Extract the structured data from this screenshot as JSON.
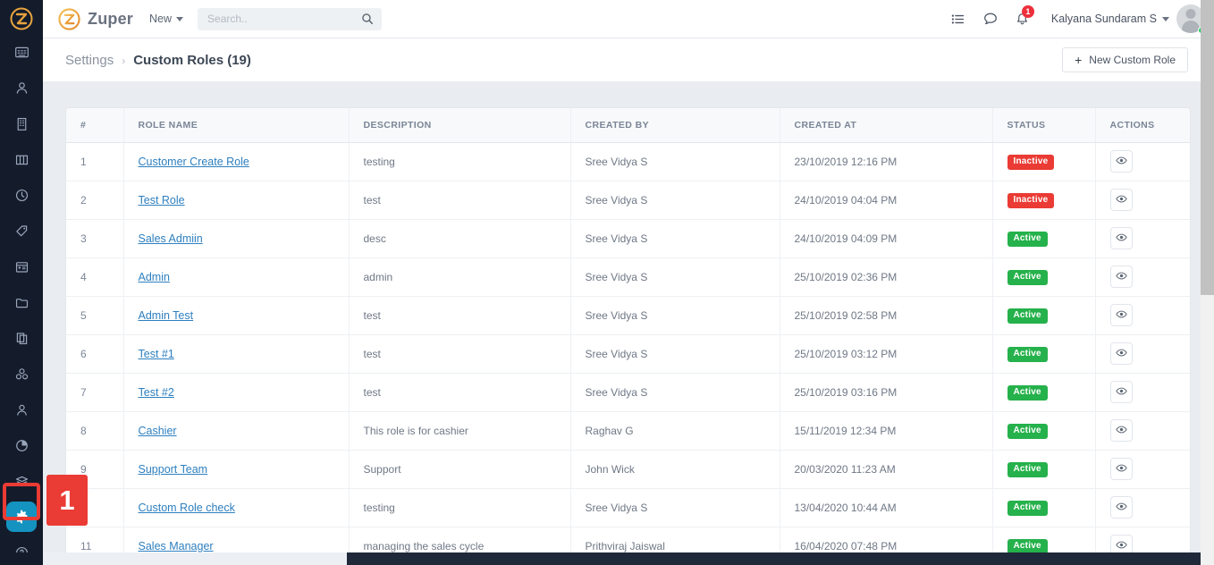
{
  "colors": {
    "rail_bg": "#141c2b",
    "accent_teal": "#1493c0",
    "annotation_red": "#ea3b34",
    "status_active": "#25b14b",
    "status_inactive": "#ea3b34",
    "link_blue": "#2d7fbf",
    "brand_orange": "#e8a33d"
  },
  "rail": {
    "logo_label": "zuper-logo",
    "items": [
      {
        "name": "dashboard-icon",
        "icon": "grid"
      },
      {
        "name": "customers-icon",
        "icon": "user-badge"
      },
      {
        "name": "properties-icon",
        "icon": "building"
      },
      {
        "name": "board-icon",
        "icon": "columns"
      },
      {
        "name": "timesheet-icon",
        "icon": "clock"
      },
      {
        "name": "tags-icon",
        "icon": "tag"
      },
      {
        "name": "calendar-icon",
        "icon": "calendar"
      },
      {
        "name": "folder-icon",
        "icon": "folder"
      },
      {
        "name": "documents-icon",
        "icon": "documents"
      },
      {
        "name": "parts-icon",
        "icon": "cubes"
      },
      {
        "name": "team-icon",
        "icon": "person"
      },
      {
        "name": "reports-icon",
        "icon": "pie"
      },
      {
        "name": "inventory-icon",
        "icon": "layers"
      },
      {
        "name": "settings-icon",
        "icon": "gear",
        "active": true
      },
      {
        "name": "help-icon",
        "icon": "question"
      }
    ]
  },
  "annotation": {
    "step_label": "1"
  },
  "topbar": {
    "brand": "Zuper",
    "new_menu": "New",
    "search_placeholder": "Search..",
    "search_value": "",
    "notification_count": "1",
    "user_name": "Kalyana Sundaram S"
  },
  "breadcrumb": {
    "root": "Settings",
    "separator": "›",
    "current": "Custom Roles (19)"
  },
  "actions": {
    "new_custom_role": "New Custom Role",
    "plus": "+"
  },
  "table": {
    "columns": [
      "#",
      "ROLE NAME",
      "DESCRIPTION",
      "CREATED BY",
      "CREATED AT",
      "STATUS",
      "ACTIONS"
    ],
    "rows": [
      {
        "idx": "1",
        "name": "Customer Create Role",
        "desc": "testing",
        "by": "Sree Vidya S",
        "at": "23/10/2019 12:16 PM",
        "status": "Inactive"
      },
      {
        "idx": "2",
        "name": "Test Role",
        "desc": "test",
        "by": "Sree Vidya S",
        "at": "24/10/2019 04:04 PM",
        "status": "Inactive"
      },
      {
        "idx": "3",
        "name": "Sales Admiin",
        "desc": "desc",
        "by": "Sree Vidya S",
        "at": "24/10/2019 04:09 PM",
        "status": "Active"
      },
      {
        "idx": "4",
        "name": "Admin",
        "desc": "admin",
        "by": "Sree Vidya S",
        "at": "25/10/2019 02:36 PM",
        "status": "Active"
      },
      {
        "idx": "5",
        "name": "Admin Test",
        "desc": "test",
        "by": "Sree Vidya S",
        "at": "25/10/2019 02:58 PM",
        "status": "Active"
      },
      {
        "idx": "6",
        "name": "Test #1",
        "desc": "test",
        "by": "Sree Vidya S",
        "at": "25/10/2019 03:12 PM",
        "status": "Active"
      },
      {
        "idx": "7",
        "name": "Test #2",
        "desc": "test",
        "by": "Sree Vidya S",
        "at": "25/10/2019 03:16 PM",
        "status": "Active"
      },
      {
        "idx": "8",
        "name": "Cashier",
        "desc": "This role is for cashier",
        "by": "Raghav G",
        "at": "15/11/2019 12:34 PM",
        "status": "Active"
      },
      {
        "idx": "9",
        "name": "Support Team",
        "desc": "Support",
        "by": "John Wick",
        "at": "20/03/2020 11:23 AM",
        "status": "Active"
      },
      {
        "idx": "",
        "name": "Custom Role check",
        "desc": "testing",
        "by": "Sree Vidya S",
        "at": "13/04/2020 10:44 AM",
        "status": "Active"
      },
      {
        "idx": "11",
        "name": "Sales Manager",
        "desc": "managing the sales cycle",
        "by": "Prithviraj Jaiswal",
        "at": "16/04/2020 07:48 PM",
        "status": "Active"
      }
    ],
    "view_action_label": "view-icon"
  }
}
